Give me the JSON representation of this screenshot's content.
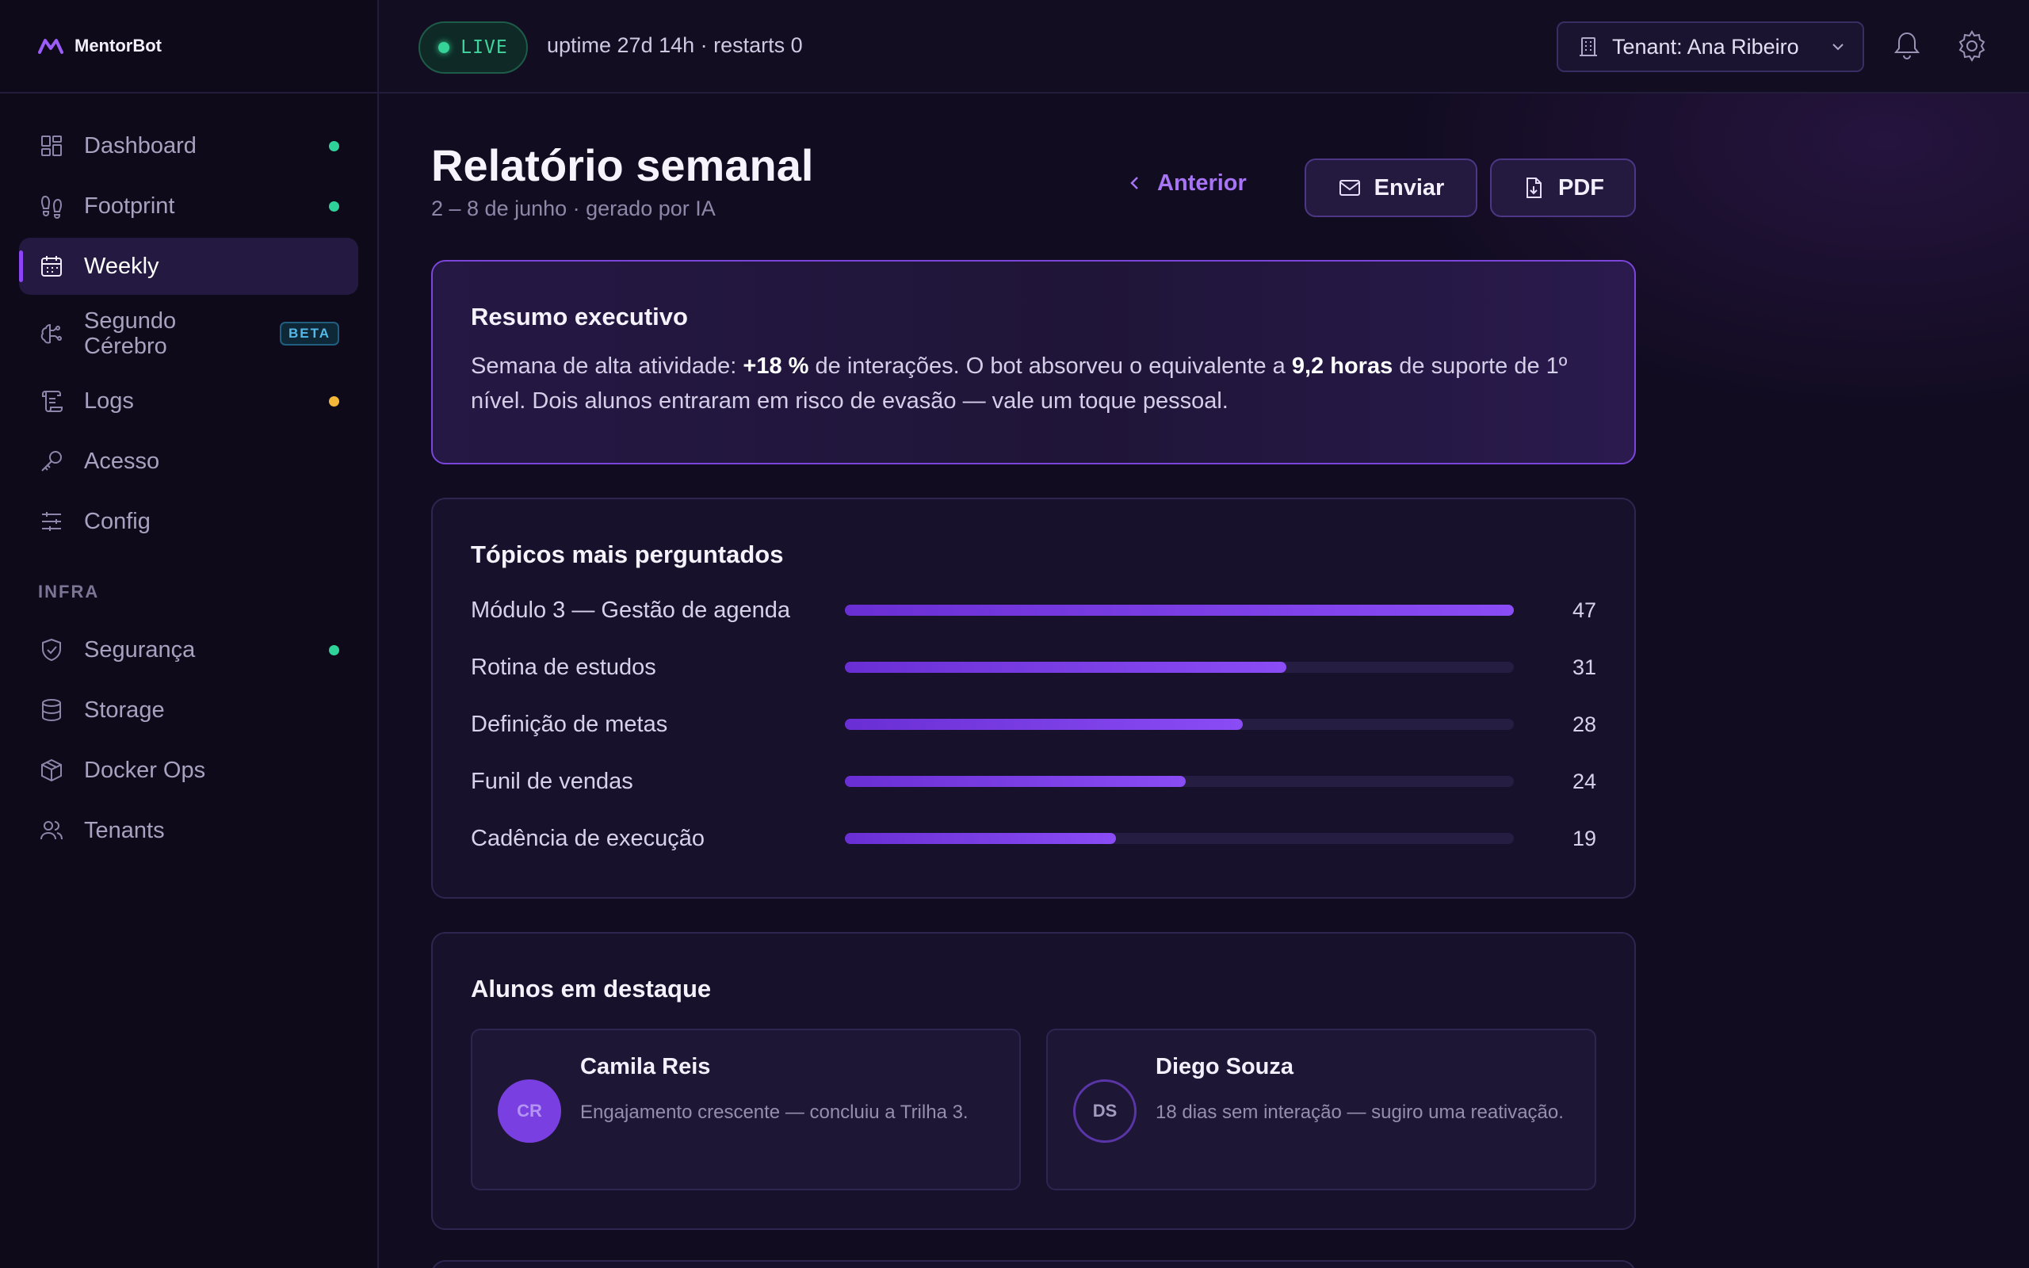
{
  "brand": {
    "name": "MentorBot"
  },
  "sidebar": {
    "items": [
      {
        "label": "Dashboard",
        "icon": "dashboard-icon",
        "status": "#2fd39a"
      },
      {
        "label": "Footprint",
        "icon": "footprint-icon",
        "status": "#2fd39a"
      },
      {
        "label": "Weekly",
        "icon": "calendar-icon",
        "active": true
      },
      {
        "label": "Segundo Cérebro",
        "icon": "brain-icon",
        "badge": "BETA"
      },
      {
        "label": "Logs",
        "icon": "scroll-icon",
        "status": "#f5b93a"
      },
      {
        "label": "Acesso",
        "icon": "key-icon"
      },
      {
        "label": "Config",
        "icon": "sliders-icon"
      }
    ],
    "section_label": "INFRA",
    "infra_items": [
      {
        "label": "Segurança",
        "icon": "shield-icon",
        "status": "#2fd39a"
      },
      {
        "label": "Storage",
        "icon": "database-icon"
      },
      {
        "label": "Docker Ops",
        "icon": "box-icon"
      },
      {
        "label": "Tenants",
        "icon": "users-icon"
      }
    ]
  },
  "topbar": {
    "live_label": "LIVE",
    "uptime": "uptime 27d 14h · restarts 0",
    "tenant": "Tenant: Ana Ribeiro"
  },
  "header": {
    "title": "Relatório semanal",
    "subtitle": "2 – 8 de junho · gerado por IA",
    "prev_label": "Anterior",
    "send_label": "Enviar",
    "pdf_label": "PDF"
  },
  "summary": {
    "title": "Resumo executivo",
    "text_1": "Semana de alta atividade: ",
    "bold_1": "+18 %",
    "text_2": " de interações. O bot absorveu o equivalente a ",
    "bold_2": "9,2 horas",
    "text_3": " de suporte de 1º nível. Dois alunos entraram em risco de evasão — vale um toque pessoal."
  },
  "topics": {
    "title": "Tópicos mais perguntados",
    "items": [
      {
        "label": "Módulo 3 — Gestão de agenda",
        "value": "47",
        "fraction": 1.0
      },
      {
        "label": "Rotina de estudos",
        "value": "31",
        "fraction": 0.66
      },
      {
        "label": "Definição de metas",
        "value": "28",
        "fraction": 0.595
      },
      {
        "label": "Funil de vendas",
        "value": "24",
        "fraction": 0.51
      },
      {
        "label": "Cadência de execução",
        "value": "19",
        "fraction": 0.405
      }
    ]
  },
  "students": {
    "title": "Alunos em destaque",
    "items": [
      {
        "initials": "CR",
        "name": "Camila Reis",
        "note": "Engajamento crescente — concluiu a Trilha 3."
      },
      {
        "initials": "DS",
        "name": "Diego Souza",
        "note": "18 dias sem interação — sugiro uma reativação."
      }
    ]
  }
}
